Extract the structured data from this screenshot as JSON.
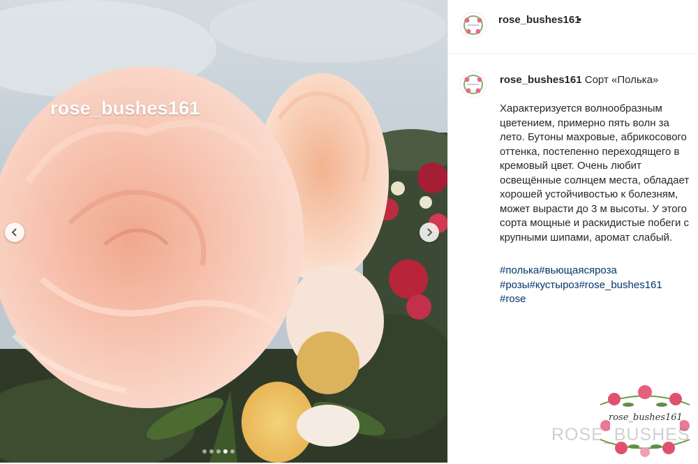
{
  "photo": {
    "watermark_text": "rose_bushes161",
    "prev_icon": "chevron-left-icon",
    "next_icon": "chevron-right-icon",
    "carousel_total": 5,
    "carousel_active": 4
  },
  "header": {
    "username": "rose_bushes161",
    "dot": "•"
  },
  "caption": {
    "username": "rose_bushes161",
    "title": "Сорт «Полька»",
    "body": "Характеризуется волнообразным цветением, примерно пять волн за лето. Бутоны махровые, абрикосового оттенка, постепенно переходящего в кремовый цвет. Очень любит освещённые солнцем места, обладает хорошей устойчивостью к болезням, может вырасти до 3 м высоты. У этого сорта мощные и раскидистые побеги с крупными шипами, аромат слабый.",
    "hashtag_lines": [
      "#полька#вьющаясяроза",
      "#розы#кустыроз#rose_bushes161",
      "#rose"
    ]
  },
  "logo": {
    "text": "rose_bushes161",
    "overlay": "ROSE_BUSHES"
  },
  "colors": {
    "hashtag": "#00376b",
    "text": "#262626",
    "petal": "#f5c4b0"
  }
}
